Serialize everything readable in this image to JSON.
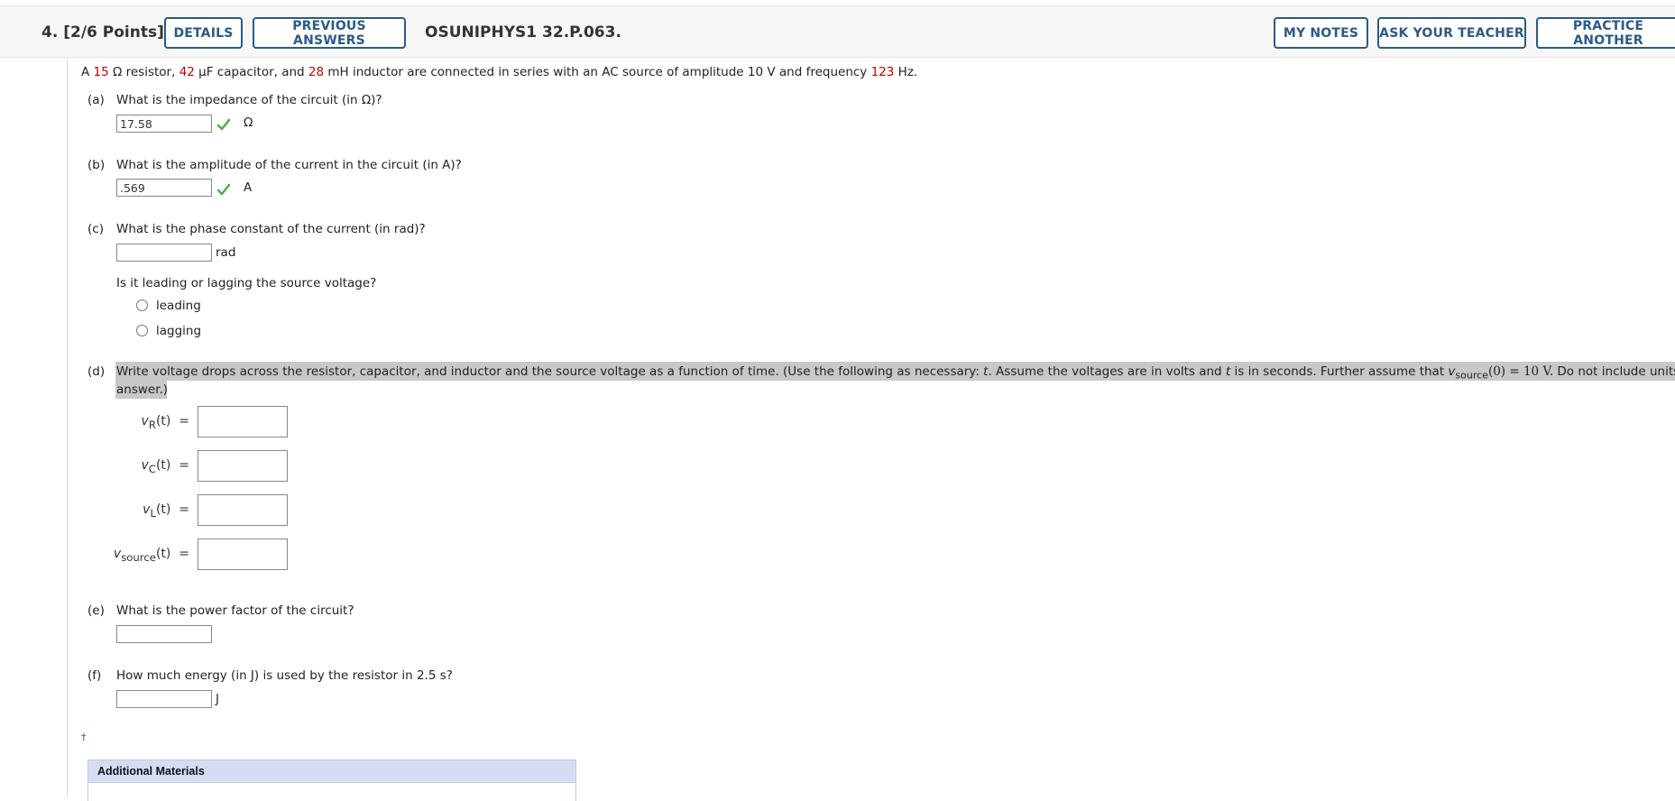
{
  "header": {
    "question_number": "4.",
    "points": "[2/6 Points]",
    "details_label": "DETAILS",
    "previous_answers_label": "PREVIOUS ANSWERS",
    "problem_code": "OSUNIPHYS1 32.P.063.",
    "my_notes_label": "MY NOTES",
    "ask_teacher_label": "ASK YOUR TEACHER",
    "practice_another_label": "PRACTICE ANOTHER"
  },
  "problem": {
    "t1": "A ",
    "resistance": "15",
    "t2": " Ω resistor, ",
    "capacitance": "42",
    "t3": " μF capacitor, and ",
    "inductance": "28",
    "t4": " mH inductor are connected in series with an AC source of amplitude 10 V and frequency ",
    "frequency": "123",
    "t5": " Hz."
  },
  "parts": {
    "a": {
      "letter": "(a)",
      "question": "What is the impedance of the circuit (in Ω)?",
      "value": "17.58",
      "unit": "Ω"
    },
    "b": {
      "letter": "(b)",
      "question": "What is the amplitude of the current in the circuit (in A)?",
      "value": ".569",
      "unit": "A"
    },
    "c": {
      "letter": "(c)",
      "question": "What is the phase constant of the current (in rad)?",
      "value": "",
      "unit": "rad",
      "sub_question": "Is it leading or lagging the source voltage?",
      "options": [
        "leading",
        "lagging"
      ]
    },
    "d": {
      "letter": "(d)",
      "q1": "Write voltage drops across the resistor, capacitor, and inductor and the source voltage as a function of time. (Use the following as necessary: ",
      "t_var": "t",
      "q2": ". Assume the voltages are in volts and ",
      "q3": " is in seconds. Further assume that ",
      "v_var": "v",
      "v_sub": "source",
      "q4": "(0) = 10 V.",
      "q5": " Do not include units in you",
      "q6": "answer.)",
      "labels": [
        {
          "v": "v",
          "sub": "R",
          "arg": "(t)",
          "eq": "="
        },
        {
          "v": "v",
          "sub": "C",
          "arg": "(t)",
          "eq": "="
        },
        {
          "v": "v",
          "sub": "L",
          "arg": "(t)",
          "eq": "="
        },
        {
          "v": "v",
          "sub": "source",
          "arg": "(t)",
          "eq": "="
        }
      ]
    },
    "e": {
      "letter": "(e)",
      "question": "What is the power factor of the circuit?",
      "value": ""
    },
    "f": {
      "letter": "(f)",
      "question": "How much energy (in J) is used by the resistor in 2.5 s?",
      "value": "",
      "unit": "J"
    }
  },
  "footnote_mark": "†",
  "additional_materials": "Additional Materials",
  "colors": {
    "accent": "#2b5a86",
    "red_value": "#c00000",
    "check_green": "#4caf50",
    "materials_bg": "#d5ddf3"
  }
}
